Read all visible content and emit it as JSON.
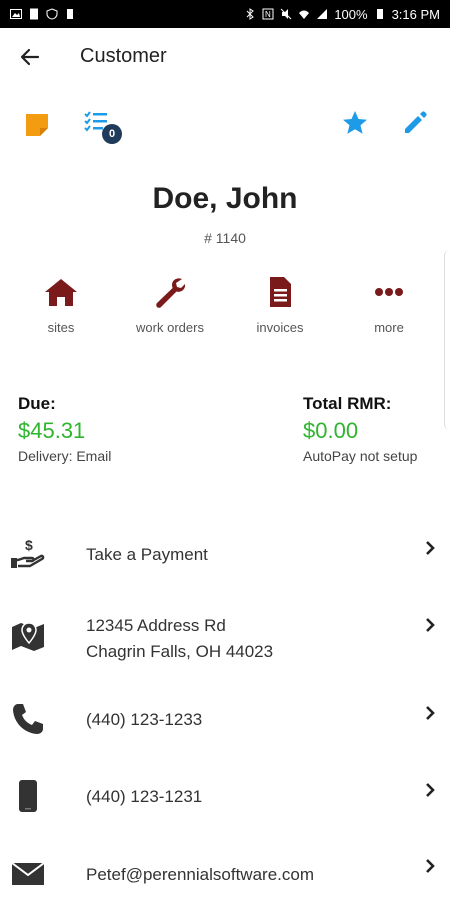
{
  "status": {
    "battery": "100%",
    "time": "3:16 PM"
  },
  "header": {
    "title": "Customer"
  },
  "toolbar": {
    "badge_count": "0"
  },
  "customer": {
    "name": "Doe, John",
    "number": "# 1140"
  },
  "nav": [
    {
      "label": "sites",
      "icon": "home-icon"
    },
    {
      "label": "work orders",
      "icon": "wrench-icon"
    },
    {
      "label": "invoices",
      "icon": "document-icon"
    },
    {
      "label": "more",
      "icon": "more-dots-icon"
    }
  ],
  "finance": {
    "due_label": "Due:",
    "due_amount": "$45.31",
    "due_sub": "Delivery: Email",
    "rmr_label": "Total RMR:",
    "rmr_amount": "$0.00",
    "rmr_sub": "AutoPay not setup"
  },
  "rows": {
    "payment": "Take a Payment",
    "address_line1": "12345 Address Rd",
    "address_line2": "Chagrin Falls, OH 44023",
    "phone": "(440) 123-1233",
    "mobile": "(440) 123-1231",
    "email": "Petef@perennialsoftware.com"
  },
  "colors": {
    "accent_dark_red": "#7a1a1a",
    "amount_green": "#2fb52f",
    "star_blue": "#1e9be8",
    "note_orange": "#f39c12"
  }
}
